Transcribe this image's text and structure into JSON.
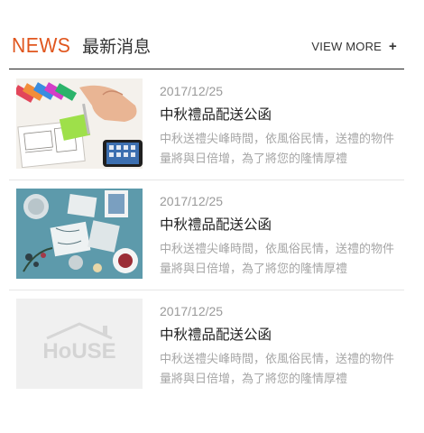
{
  "header": {
    "title_en": "NEWS",
    "title_zh": "最新消息",
    "view_more": "VIEW MORE",
    "plus": "+"
  },
  "colors": {
    "accent": "#e0561e",
    "title_text": "#222222",
    "muted_text": "#a6a6a6",
    "date_text": "#9a9a9a"
  },
  "news_items": [
    {
      "date": "2017/12/25",
      "title": "中秋禮品配送公函",
      "excerpt": "中秋送禮尖峰時間，依風俗民情，送禮的物件量將與日倍增，為了將您的隆情厚禮",
      "image": "sketching-hand-photo"
    },
    {
      "date": "2017/12/25",
      "title": "中秋禮品配送公函",
      "excerpt": "中秋送禮尖峰時間，依風俗民情，送禮的物件量將與日倍增，為了將您的隆情厚禮",
      "image": "flatlay-teatime-photo"
    },
    {
      "date": "2017/12/25",
      "title": "中秋禮品配送公函",
      "excerpt": "中秋送禮尖峰時間，依風俗民情，送禮的物件量將與日倍增，為了將您的隆情厚禮",
      "image": "house-logo-placeholder",
      "placeholder_text": "HoUSE"
    }
  ]
}
